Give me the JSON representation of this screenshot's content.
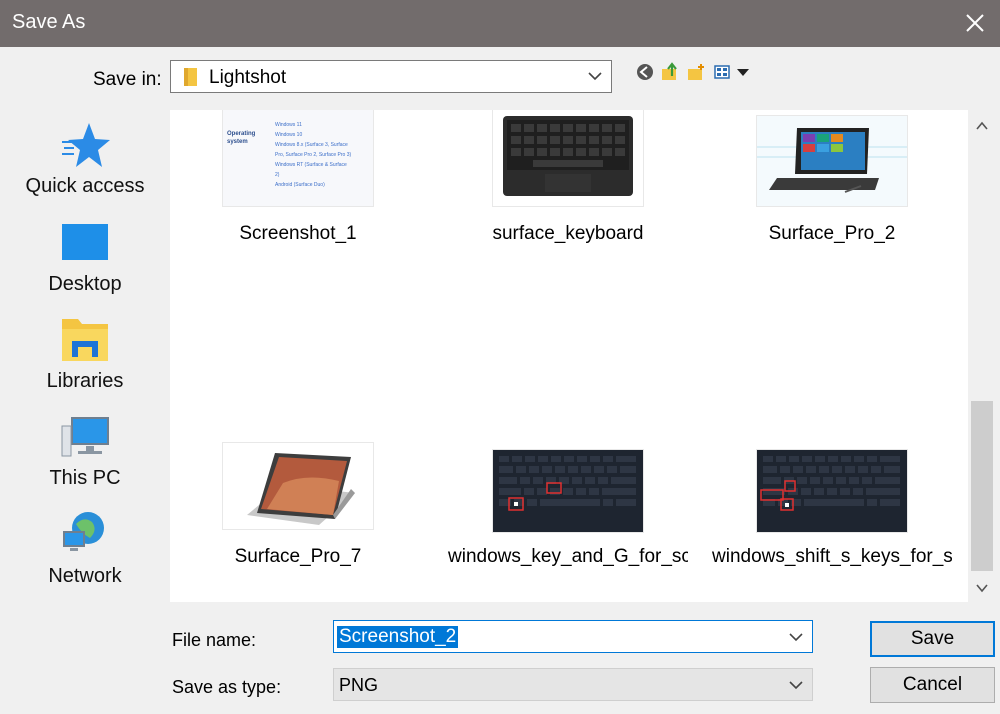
{
  "window": {
    "title": "Save As",
    "close_glyph": "✕"
  },
  "save_in": {
    "label": "Save in:",
    "value": "Lightshot"
  },
  "toolbar": {
    "icons": [
      "back-icon",
      "up-folder-icon",
      "new-folder-icon",
      "view-menu-icon"
    ]
  },
  "places": [
    {
      "label": "Quick access",
      "icon": "star-icon"
    },
    {
      "label": "Desktop",
      "icon": "desktop-icon"
    },
    {
      "label": "Libraries",
      "icon": "libraries-icon"
    },
    {
      "label": "This PC",
      "icon": "computer-icon"
    },
    {
      "label": "Network",
      "icon": "network-icon"
    }
  ],
  "files": [
    {
      "name": "Screenshot_1",
      "preview": {
        "heading": "Operating system",
        "lines": [
          "Windows 11",
          "Windows 10",
          "Windows 8.x (Surface 3, Surface",
          "Pro, Surface Pro 2, Surface Pro 3)",
          "Windows RT (Surface & Surface",
          "2)",
          "Android (Surface Duo)"
        ]
      }
    },
    {
      "name": "surface_keyboard"
    },
    {
      "name": "Surface_Pro_2"
    },
    {
      "name": "Surface_Pro_7"
    },
    {
      "name": "windows_key_and_G_for_sc..."
    },
    {
      "name": "windows_shift_s_keys_for_s..."
    }
  ],
  "file_name": {
    "label": "File name:",
    "value": "Screenshot_2"
  },
  "save_as_type": {
    "label": "Save as type:",
    "value": "PNG"
  },
  "buttons": {
    "save": "Save",
    "cancel": "Cancel"
  },
  "colors": {
    "titlebar": "#726c6c",
    "accent": "#0078d7",
    "folder": "#f4c542"
  }
}
